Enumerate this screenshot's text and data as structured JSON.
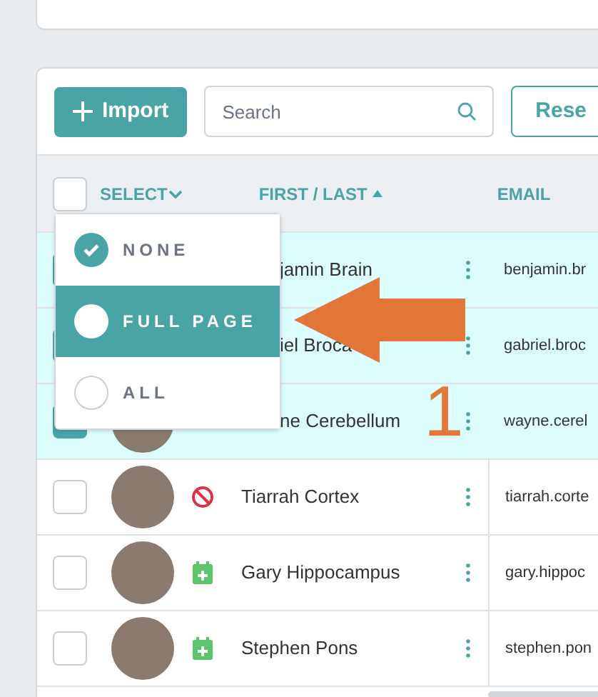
{
  "toolbar": {
    "import_button": "Import",
    "search": {
      "placeholder": "Search"
    },
    "button_3": "Rese"
  },
  "table": {
    "header": {
      "select_all_checked": false,
      "select": "SELECT",
      "name": "FIRST / LAST",
      "email": "EMAIL"
    },
    "rows": [
      {
        "selected": true,
        "name": "jamin Brain",
        "email": "benjamin.br",
        "kind": "plain",
        "covered": true
      },
      {
        "selected": true,
        "name": "iel Broca",
        "email": "gabriel.broc",
        "kind": "plain",
        "covered": true
      },
      {
        "selected": true,
        "name": "ne Cerebellum",
        "email": "wayne.cerel",
        "kind": "plain",
        "covered": true
      },
      {
        "selected": false,
        "name": "Tiarrah Cortex",
        "email": "tiarrah.corte",
        "kind": "blocked",
        "covered": false
      },
      {
        "selected": false,
        "name": "Gary Hippocampus",
        "email": "gary.hippoc",
        "kind": "scheduled",
        "covered": false
      },
      {
        "selected": false,
        "name": "Stephen Pons",
        "email": "stephen.pon",
        "kind": "scheduled",
        "covered": false
      }
    ]
  },
  "select_menu": [
    {
      "label": "NONE",
      "checked": true,
      "selected": false
    },
    {
      "label": "FULL PAGE",
      "checked": false,
      "selected": true
    },
    {
      "label": "ALL",
      "checked": false,
      "selected": false
    }
  ],
  "annotation": {
    "number": "1"
  }
}
